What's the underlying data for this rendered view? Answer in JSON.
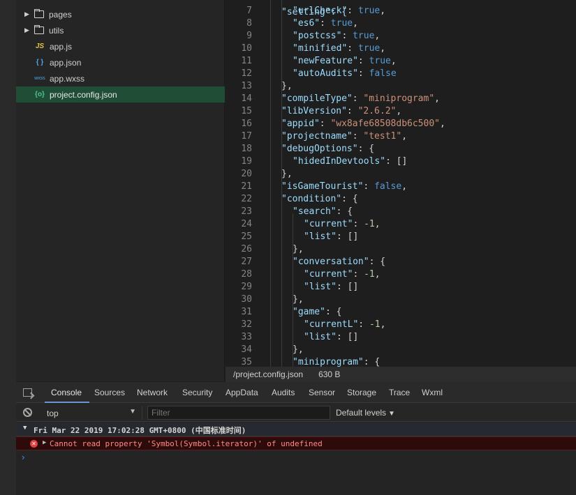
{
  "explorer": {
    "items": [
      {
        "label": "pages",
        "type": "folder"
      },
      {
        "label": "utils",
        "type": "folder"
      },
      {
        "label": "app.js",
        "type": "js",
        "icon": "JS"
      },
      {
        "label": "app.json",
        "type": "json",
        "icon": "{ }"
      },
      {
        "label": "app.wxss",
        "type": "wxss",
        "icon": "wxss"
      },
      {
        "label": "project.config.json",
        "type": "config",
        "icon": "{o}"
      }
    ]
  },
  "editor": {
    "partial_top_line": "\"setting\": {",
    "lines": [
      {
        "num": "7",
        "key": "urlCheck",
        "value": "true",
        "vtype": "b",
        "tail": ","
      },
      {
        "num": "8",
        "key": "es6",
        "value": "true",
        "vtype": "b",
        "tail": ","
      },
      {
        "num": "9",
        "key": "postcss",
        "value": "true",
        "vtype": "b",
        "tail": ","
      },
      {
        "num": "10",
        "key": "minified",
        "value": "true",
        "vtype": "b",
        "tail": ","
      },
      {
        "num": "11",
        "key": "newFeature",
        "value": "true",
        "vtype": "b",
        "tail": ","
      },
      {
        "num": "12",
        "key": "autoAudits",
        "value": "false",
        "vtype": "b",
        "tail": ""
      },
      {
        "num": "13",
        "key": "",
        "value": "},",
        "vtype": "p",
        "tail": ""
      },
      {
        "num": "14",
        "key": "compileType",
        "value": "\"miniprogram\"",
        "vtype": "s",
        "tail": ","
      },
      {
        "num": "15",
        "key": "libVersion",
        "value": "\"2.6.2\"",
        "vtype": "s",
        "tail": ","
      },
      {
        "num": "16",
        "key": "appid",
        "value": "\"wx8afe68508db6c500\"",
        "vtype": "s",
        "tail": ","
      },
      {
        "num": "17",
        "key": "projectname",
        "value": "\"test1\"",
        "vtype": "s",
        "tail": ","
      },
      {
        "num": "18",
        "key": "debugOptions",
        "value": "{",
        "vtype": "p",
        "tail": ""
      },
      {
        "num": "19",
        "key": "hidedInDevtools",
        "value": "[]",
        "vtype": "p",
        "tail": ""
      },
      {
        "num": "20",
        "key": "",
        "value": "},",
        "vtype": "p",
        "tail": ""
      },
      {
        "num": "21",
        "key": "isGameTourist",
        "value": "false",
        "vtype": "b",
        "tail": ","
      },
      {
        "num": "22",
        "key": "condition",
        "value": "{",
        "vtype": "p",
        "tail": ""
      },
      {
        "num": "23",
        "key": "search",
        "value": "{",
        "vtype": "p",
        "tail": ""
      },
      {
        "num": "24",
        "key": "current",
        "value": "-1",
        "vtype": "n",
        "tail": ","
      },
      {
        "num": "25",
        "key": "list",
        "value": "[]",
        "vtype": "p",
        "tail": ""
      },
      {
        "num": "26",
        "key": "",
        "value": "},",
        "vtype": "p",
        "tail": ""
      },
      {
        "num": "27",
        "key": "conversation",
        "value": "{",
        "vtype": "p",
        "tail": ""
      },
      {
        "num": "28",
        "key": "current",
        "value": "-1",
        "vtype": "n",
        "tail": ","
      },
      {
        "num": "29",
        "key": "list",
        "value": "[]",
        "vtype": "p",
        "tail": ""
      },
      {
        "num": "30",
        "key": "",
        "value": "},",
        "vtype": "p",
        "tail": ""
      },
      {
        "num": "31",
        "key": "game",
        "value": "{",
        "vtype": "p",
        "tail": ""
      },
      {
        "num": "32",
        "key": "currentL",
        "value": "-1",
        "vtype": "n",
        "tail": ","
      },
      {
        "num": "33",
        "key": "list",
        "value": "[]",
        "vtype": "p",
        "tail": ""
      },
      {
        "num": "34",
        "key": "",
        "value": "},",
        "vtype": "p",
        "tail": ""
      },
      {
        "num": "35",
        "key": "miniprogram",
        "value": "{",
        "vtype": "p",
        "tail": ""
      }
    ]
  },
  "statusbar": {
    "path": "/project.config.json",
    "size": "630 B"
  },
  "console": {
    "tabs": [
      "Console",
      "Sources",
      "Network",
      "Security",
      "AppData",
      "Audits",
      "Sensor",
      "Storage",
      "Trace",
      "Wxml"
    ],
    "context": "top",
    "filter_placeholder": "Filter",
    "levels": "Default levels",
    "group_header": "Fri Mar 22 2019 17:02:28 GMT+0800 (中国标准时间)",
    "error_message": "Cannot read property 'Symbol(Symbol.iterator)' of undefined",
    "prompt_symbol": "›"
  }
}
